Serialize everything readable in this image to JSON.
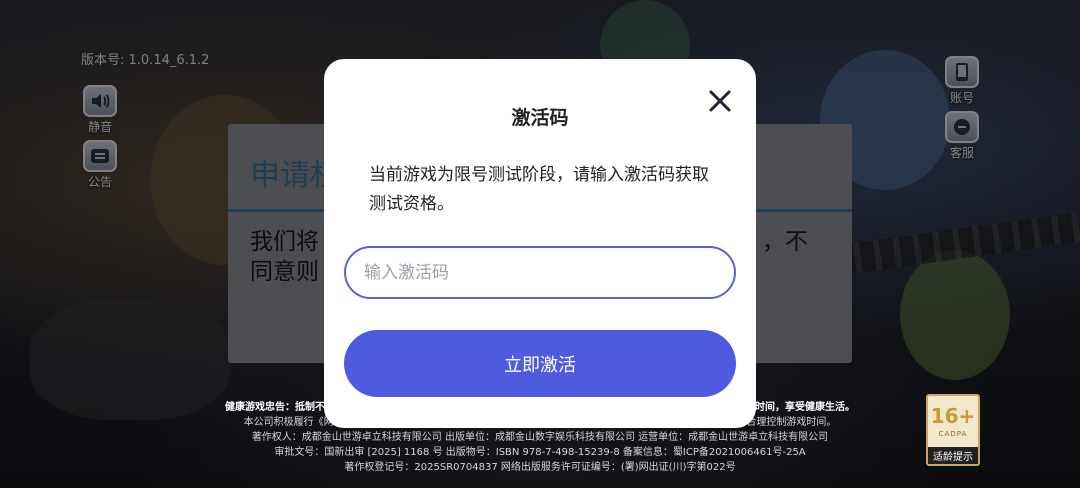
{
  "hud": {
    "version": "版本号: 1.0.14_6.1.2",
    "mute_label": "静音",
    "notice_label": "公告",
    "account_label": "账号",
    "service_label": "客服"
  },
  "background_dialog": {
    "title_fragment": "申请权",
    "body_line1_left": "我们将",
    "body_line2_left": "同意则",
    "body_line1_right": "，不"
  },
  "legal": {
    "health_warning": "健康游戏忠告：抵制不良游戏，拒绝盗版游戏。注意自我保护，谨防受骗上当。适度游戏益脑，沉迷游戏伤身。合理安排时间，享受健康生活。",
    "line1": "本公司积极履行《网络游戏行业防沉迷自律公约》本网络游戏适合年满16周岁以上的用户使用，为了您的健康，请合理控制游戏时间。",
    "line2": "著作权人：成都金山世游卓立科技有限公司 出版单位：成都金山数字娱乐科技有限公司 运营单位：成都金山世游卓立科技有限公司",
    "line3": "审批文号：国新出审 [2025] 1168 号 出版物号：ISBN 978-7-498-15239-8 备案信息：蜀ICP备2021006461号-25A",
    "line4": "著作权登记号：2025SR0704837 网络出版服务许可证编号：(署)网出证(川)字第022号"
  },
  "age_rating": {
    "value": "16+",
    "org": "CADPA",
    "tip": "适龄提示"
  },
  "modal": {
    "title": "激活码",
    "description": "当前游戏为限号测试阶段，请输入激活码获取测试资格。",
    "input_placeholder": "输入激活码",
    "input_value": "",
    "activate_label": "立即激活"
  },
  "colors": {
    "accent": "#4f5bdf",
    "input_border": "#5a60d8"
  }
}
